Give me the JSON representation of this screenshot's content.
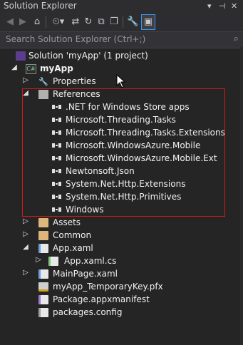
{
  "window": {
    "title": "Solution Explorer",
    "pin_glyphs": [
      "▾",
      "⊣",
      "✕"
    ]
  },
  "search": {
    "placeholder": "Search Solution Explorer (Ctrl+;)"
  },
  "tree": {
    "solution": "Solution 'myApp' (1 project)",
    "project": "myApp",
    "project_badge": "C#",
    "properties": "Properties",
    "references": "References",
    "reference_items": [
      ".NET for Windows Store apps",
      "Microsoft.Threading.Tasks",
      "Microsoft.Threading.Tasks.Extensions",
      "Microsoft.WindowsAzure.Mobile",
      "Microsoft.WindowsAzure.Mobile.Ext",
      "Newtonsoft.Json",
      "System.Net.Http.Extensions",
      "System.Net.Http.Primitives",
      "Windows"
    ],
    "assets": "Assets",
    "common": "Common",
    "app_xaml": "App.xaml",
    "app_xaml_cs": "App.xaml.cs",
    "main_page": "MainPage.xaml",
    "temp_key": "myApp_TemporaryKey.pfx",
    "manifest": "Package.appxmanifest",
    "packages": "packages.config"
  },
  "colors": {
    "background": "#252526",
    "selection_box": "#d11a1a",
    "folder": "#dcb67a",
    "accent": "#3399ff"
  }
}
